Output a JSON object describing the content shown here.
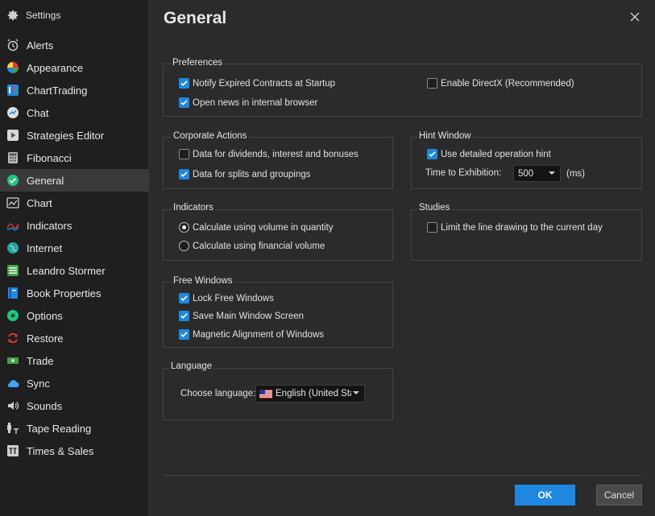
{
  "sidebar": {
    "header": "Settings",
    "items": [
      {
        "label": "Alerts"
      },
      {
        "label": "Appearance"
      },
      {
        "label": "ChartTrading"
      },
      {
        "label": "Chat"
      },
      {
        "label": "Strategies Editor"
      },
      {
        "label": "Fibonacci"
      },
      {
        "label": "General"
      },
      {
        "label": "Chart"
      },
      {
        "label": "Indicators"
      },
      {
        "label": "Internet"
      },
      {
        "label": "Leandro Stormer"
      },
      {
        "label": "Book Properties"
      },
      {
        "label": "Options"
      },
      {
        "label": "Restore"
      },
      {
        "label": "Trade"
      },
      {
        "label": "Sync"
      },
      {
        "label": "Sounds"
      },
      {
        "label": "Tape Reading"
      },
      {
        "label": "Times & Sales"
      }
    ],
    "active": "General"
  },
  "main": {
    "title": "General",
    "preferences": {
      "title": "Preferences",
      "notify_expired": {
        "label": "Notify Expired Contracts at Startup",
        "checked": true
      },
      "open_news": {
        "label": "Open news in internal browser",
        "checked": true
      },
      "enable_directx": {
        "label": "Enable DirectX (Recommended)",
        "checked": false
      }
    },
    "corporate_actions": {
      "title": "Corporate Actions",
      "dividends": {
        "label": "Data for dividends, interest and bonuses",
        "checked": false
      },
      "splits": {
        "label": "Data for splits and groupings",
        "checked": true
      }
    },
    "hint_window": {
      "title": "Hint Window",
      "detailed_hint": {
        "label": "Use detailed operation hint",
        "checked": true
      },
      "time_label": "Time to Exhibition:",
      "time_value": "500",
      "time_unit": "(ms)"
    },
    "indicators": {
      "title": "Indicators",
      "volume_quantity": {
        "label": "Calculate using volume in quantity",
        "selected": true
      },
      "financial_volume": {
        "label": "Calculate using financial volume",
        "selected": false
      }
    },
    "studies": {
      "title": "Studies",
      "limit_line": {
        "label": "Limit the line drawing to the current day",
        "checked": false
      }
    },
    "free_windows": {
      "title": "Free Windows",
      "lock": {
        "label": "Lock Free Windows",
        "checked": true
      },
      "save_main": {
        "label": "Save Main Window Screen",
        "checked": true
      },
      "magnetic": {
        "label": "Magnetic Alignment of Windows",
        "checked": true
      }
    },
    "language": {
      "title": "Language",
      "choose_label": "Choose language:",
      "selected": "English (United Stat"
    }
  },
  "footer": {
    "ok_label": "OK",
    "cancel_label": "Cancel"
  },
  "colors": {
    "accent": "#1f87e0",
    "background": "#2b2b2b",
    "sidebar_bg": "#1f1f1f"
  }
}
